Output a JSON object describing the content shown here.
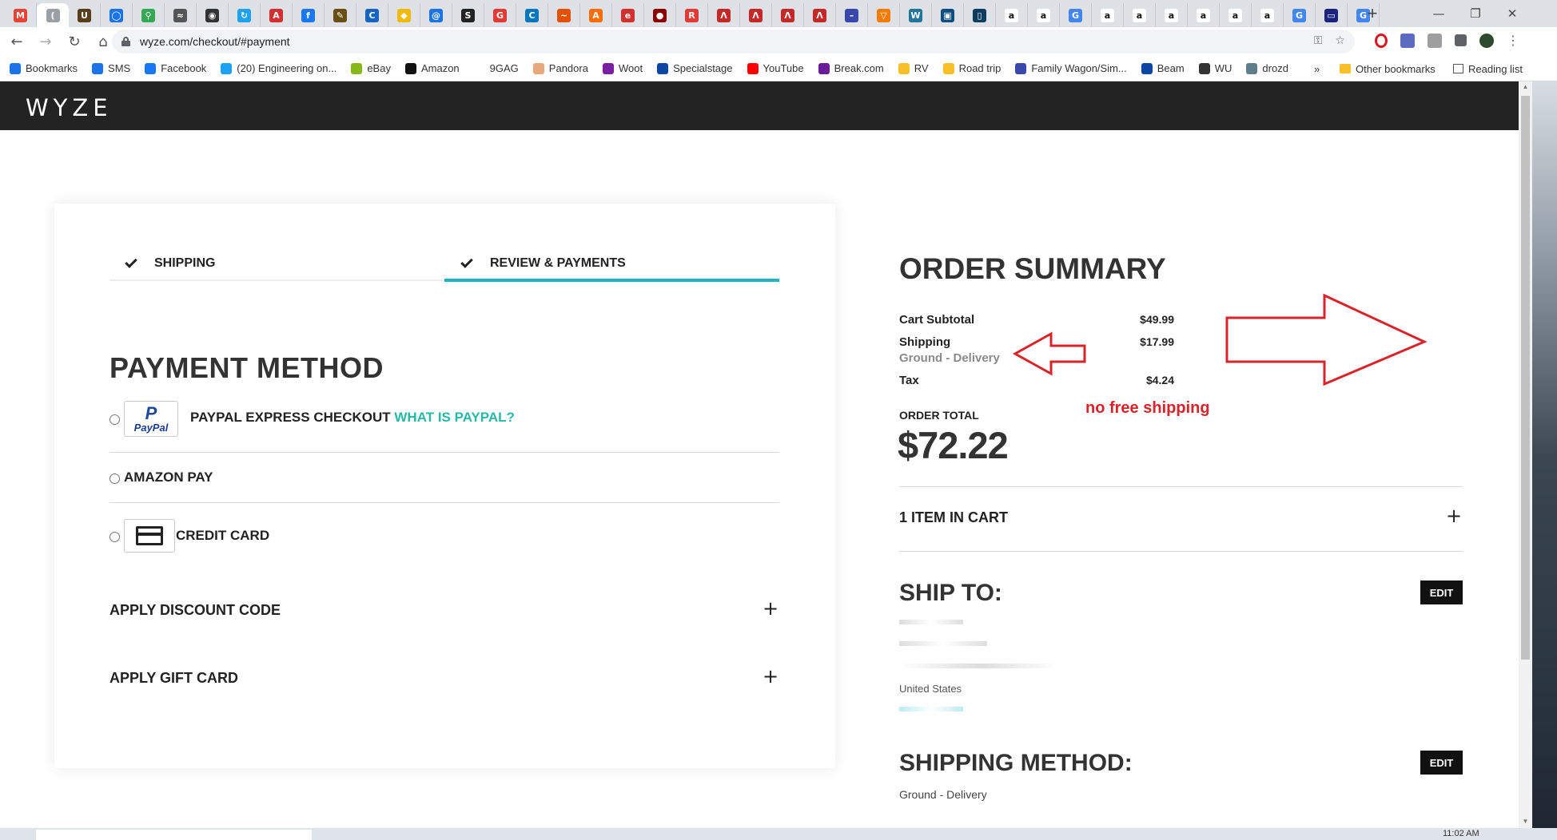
{
  "browser": {
    "url": "wyze.com/checkout/#payment",
    "tab_favicons": [
      {
        "name": "gmail-icon",
        "color": "#ea4335",
        "glyph": "M"
      },
      {
        "name": "loading-icon",
        "color": "#9aa0a6",
        "glyph": "("
      },
      {
        "name": "ups-icon",
        "color": "#5a3d1a",
        "glyph": "U"
      },
      {
        "name": "chat-icon",
        "color": "#1a73e8",
        "glyph": "◯"
      },
      {
        "name": "maps-icon",
        "color": "#34a853",
        "glyph": "⚲"
      },
      {
        "name": "wave-icon",
        "color": "#555555",
        "glyph": "≈"
      },
      {
        "name": "globe-icon",
        "color": "#333333",
        "glyph": "◉"
      },
      {
        "name": "refresh-site-icon",
        "color": "#1da1f2",
        "glyph": "↻"
      },
      {
        "name": "acrobat-icon",
        "color": "#d32f2f",
        "glyph": "A"
      },
      {
        "name": "facebook-icon",
        "color": "#1877f2",
        "glyph": "f"
      },
      {
        "name": "edit-site-icon",
        "color": "#6b4e16",
        "glyph": "✎"
      },
      {
        "name": "c-site-icon",
        "color": "#1565c0",
        "glyph": "C"
      },
      {
        "name": "binance-icon",
        "color": "#f0b90b",
        "glyph": "◆"
      },
      {
        "name": "at-icon",
        "color": "#1a73e8",
        "glyph": "@"
      },
      {
        "name": "s-site-icon",
        "color": "#222222",
        "glyph": "S"
      },
      {
        "name": "g-red-icon",
        "color": "#e53935",
        "glyph": "G"
      },
      {
        "name": "cdc-icon",
        "color": "#0277bd",
        "glyph": "C"
      },
      {
        "name": "squiggle-icon",
        "color": "#e65100",
        "glyph": "~"
      },
      {
        "name": "ai-icon",
        "color": "#ff6d00",
        "glyph": "A"
      },
      {
        "name": "ep-icon",
        "color": "#d32f2f",
        "glyph": "e"
      },
      {
        "name": "dark-red-icon",
        "color": "#8b0000",
        "glyph": "●"
      },
      {
        "name": "red-circle-icon",
        "color": "#e53935",
        "glyph": "R"
      },
      {
        "name": "airbnb-icon",
        "color": "#c62828",
        "glyph": "Λ"
      },
      {
        "name": "airbnb-icon-2",
        "color": "#c62828",
        "glyph": "Λ"
      },
      {
        "name": "airbnb-icon-3",
        "color": "#c62828",
        "glyph": "Λ"
      },
      {
        "name": "airbnb-icon-4",
        "color": "#c62828",
        "glyph": "Λ"
      },
      {
        "name": "dash-icon",
        "color": "#3949ab",
        "glyph": "–"
      },
      {
        "name": "triangle-icon",
        "color": "#f57c00",
        "glyph": "▽"
      },
      {
        "name": "wordpress-icon",
        "color": "#21759b",
        "glyph": "W"
      },
      {
        "name": "doc-icon",
        "color": "#0b4f82",
        "glyph": "▣"
      },
      {
        "name": "bracket-icon",
        "color": "#0d3c61",
        "glyph": "▯"
      },
      {
        "name": "amazon-icon",
        "color": "#111111",
        "glyph": "a"
      },
      {
        "name": "amazon-icon-2",
        "color": "#111111",
        "glyph": "a"
      },
      {
        "name": "google-icon",
        "color": "#4285f4",
        "glyph": "G"
      },
      {
        "name": "amazon-icon-3",
        "color": "#111111",
        "glyph": "a"
      },
      {
        "name": "amazon-icon-4",
        "color": "#111111",
        "glyph": "a"
      },
      {
        "name": "amazon-icon-5",
        "color": "#111111",
        "glyph": "a"
      },
      {
        "name": "amazon-icon-6",
        "color": "#111111",
        "glyph": "a"
      },
      {
        "name": "amazon-icon-7",
        "color": "#111111",
        "glyph": "a"
      },
      {
        "name": "amazon-icon-8",
        "color": "#111111",
        "glyph": "a"
      },
      {
        "name": "google-icon-2",
        "color": "#4285f4",
        "glyph": "G"
      },
      {
        "name": "screen-icon",
        "color": "#1a237e",
        "glyph": "▭"
      },
      {
        "name": "google-icon-3",
        "color": "#4285f4",
        "glyph": "G"
      }
    ],
    "bookmarks": [
      {
        "label": "Bookmarks",
        "color": "#1a73e8"
      },
      {
        "label": "SMS",
        "color": "#1a73e8"
      },
      {
        "label": "Facebook",
        "color": "#1877f2"
      },
      {
        "label": "(20) Engineering on...",
        "color": "#1da1f2"
      },
      {
        "label": "eBay",
        "color": "#86b817"
      },
      {
        "label": "Amazon",
        "color": "#111111"
      },
      {
        "label": "9GAG",
        "color": "#ffffff"
      },
      {
        "label": "Pandora",
        "color": "#e8a87c"
      },
      {
        "label": "Woot",
        "color": "#7b1fa2"
      },
      {
        "label": "Specialstage",
        "color": "#0d47a1"
      },
      {
        "label": "YouTube",
        "color": "#ff0000"
      },
      {
        "label": "Break.com",
        "color": "#6a1b9a"
      },
      {
        "label": "RV",
        "color": "#f6c026"
      },
      {
        "label": "Road trip",
        "color": "#f6c026"
      },
      {
        "label": "Family Wagon/Sim...",
        "color": "#3949ab"
      },
      {
        "label": "Beam",
        "color": "#0d47a1"
      },
      {
        "label": "WU",
        "color": "#333333"
      },
      {
        "label": "drozd",
        "color": "#607d8b"
      }
    ],
    "bookmarks_overflow": "»",
    "other_bookmarks": "Other bookmarks",
    "reading_list": "Reading list"
  },
  "site": {
    "logo": "WYZE"
  },
  "checkout": {
    "steps": [
      {
        "label": "SHIPPING",
        "active": false
      },
      {
        "label": "REVIEW & PAYMENTS",
        "active": true
      }
    ],
    "accent_color": "#1eb4c4",
    "payment_method_title": "PAYMENT METHOD",
    "payment_options": [
      {
        "label": "PAYPAL EXPRESS CHECKOUT",
        "link": "WHAT IS PAYPAL?",
        "logo_text": "PayPal"
      },
      {
        "label": "AMAZON PAY"
      },
      {
        "label": "CREDIT CARD"
      }
    ],
    "discount_label": "APPLY DISCOUNT CODE",
    "gift_card_label": "APPLY GIFT CARD",
    "expand_symbol": "+"
  },
  "order_summary": {
    "title": "ORDER SUMMARY",
    "cart_subtotal_label": "Cart Subtotal",
    "cart_subtotal": "$49.99",
    "shipping_label": "Shipping",
    "shipping_method": "Ground - Delivery",
    "shipping_cost": "$17.99",
    "tax_label": "Tax",
    "tax": "$4.24",
    "order_total_label": "ORDER TOTAL",
    "order_total": "$72.22",
    "cart_count_label": "1 ITEM IN CART",
    "ship_to_title": "SHIP TO:",
    "edit_label": "EDIT",
    "address_country": "United States",
    "shipping_method_title": "SHIPPING METHOD:",
    "shipping_method_value": "Ground - Delivery"
  },
  "annotation": {
    "text": "no free shipping",
    "color": "#d8232a"
  },
  "taskbar": {
    "clock": "11:02 AM"
  }
}
